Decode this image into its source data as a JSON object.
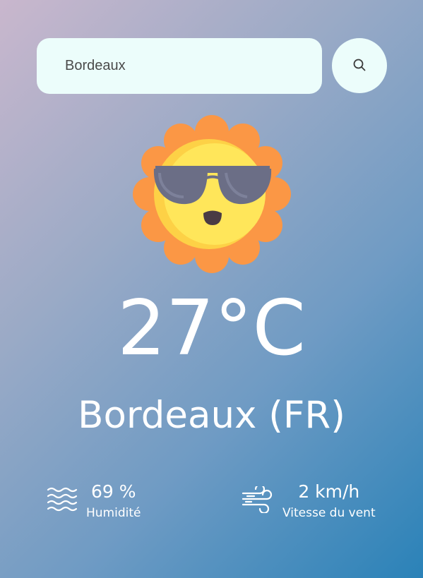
{
  "search": {
    "value": "Bordeaux"
  },
  "weather": {
    "icon": "sun-with-sunglasses-icon",
    "temperature": "27°C",
    "location": "Bordeaux (FR)"
  },
  "stats": {
    "humidity": {
      "icon": "water-waves-icon",
      "value": "69 %",
      "label": "Humidité"
    },
    "wind": {
      "icon": "wind-icon",
      "value": "2 km/h",
      "label": "Vitesse du vent"
    }
  },
  "colors": {
    "gradient_start": "#c9b7cd",
    "gradient_end": "#2a82b8",
    "input_background": "#ecfdfb",
    "sun_outer": "#fb9745",
    "sun_inner": "#ffdf50",
    "glasses": "#6b6e86"
  }
}
